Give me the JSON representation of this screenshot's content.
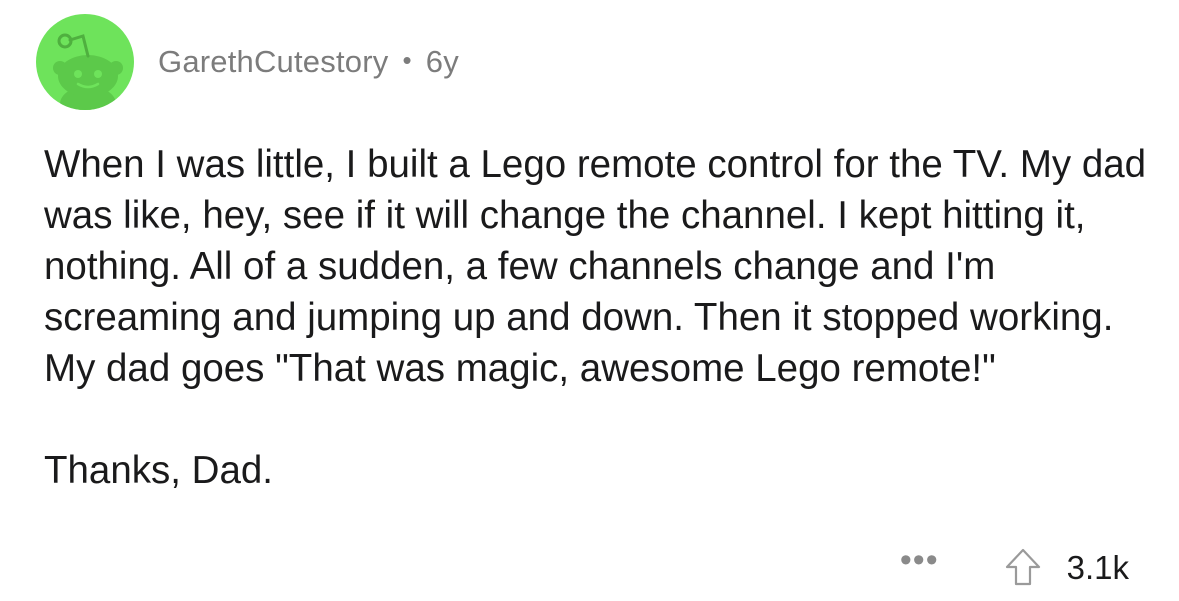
{
  "comment": {
    "author": "GarethCutestory",
    "separator": "•",
    "age": "6y",
    "avatar_icon": "reddit-snoo-icon",
    "avatar_color": "#6ee35b",
    "body": [
      "When I was little, I built a Lego remote control for the TV. My dad was like, hey, see if it will change the channel. I kept hitting it, nothing. All of a sudden, a few channels change and I'm screaming and jumping up and down. Then it stopped working. My dad goes \"That was magic, awesome Lego remote!\"",
      "Thanks, Dad."
    ],
    "actions": {
      "more_label": "•••",
      "upvote_icon": "upvote-arrow-icon",
      "score": "3.1k"
    }
  }
}
